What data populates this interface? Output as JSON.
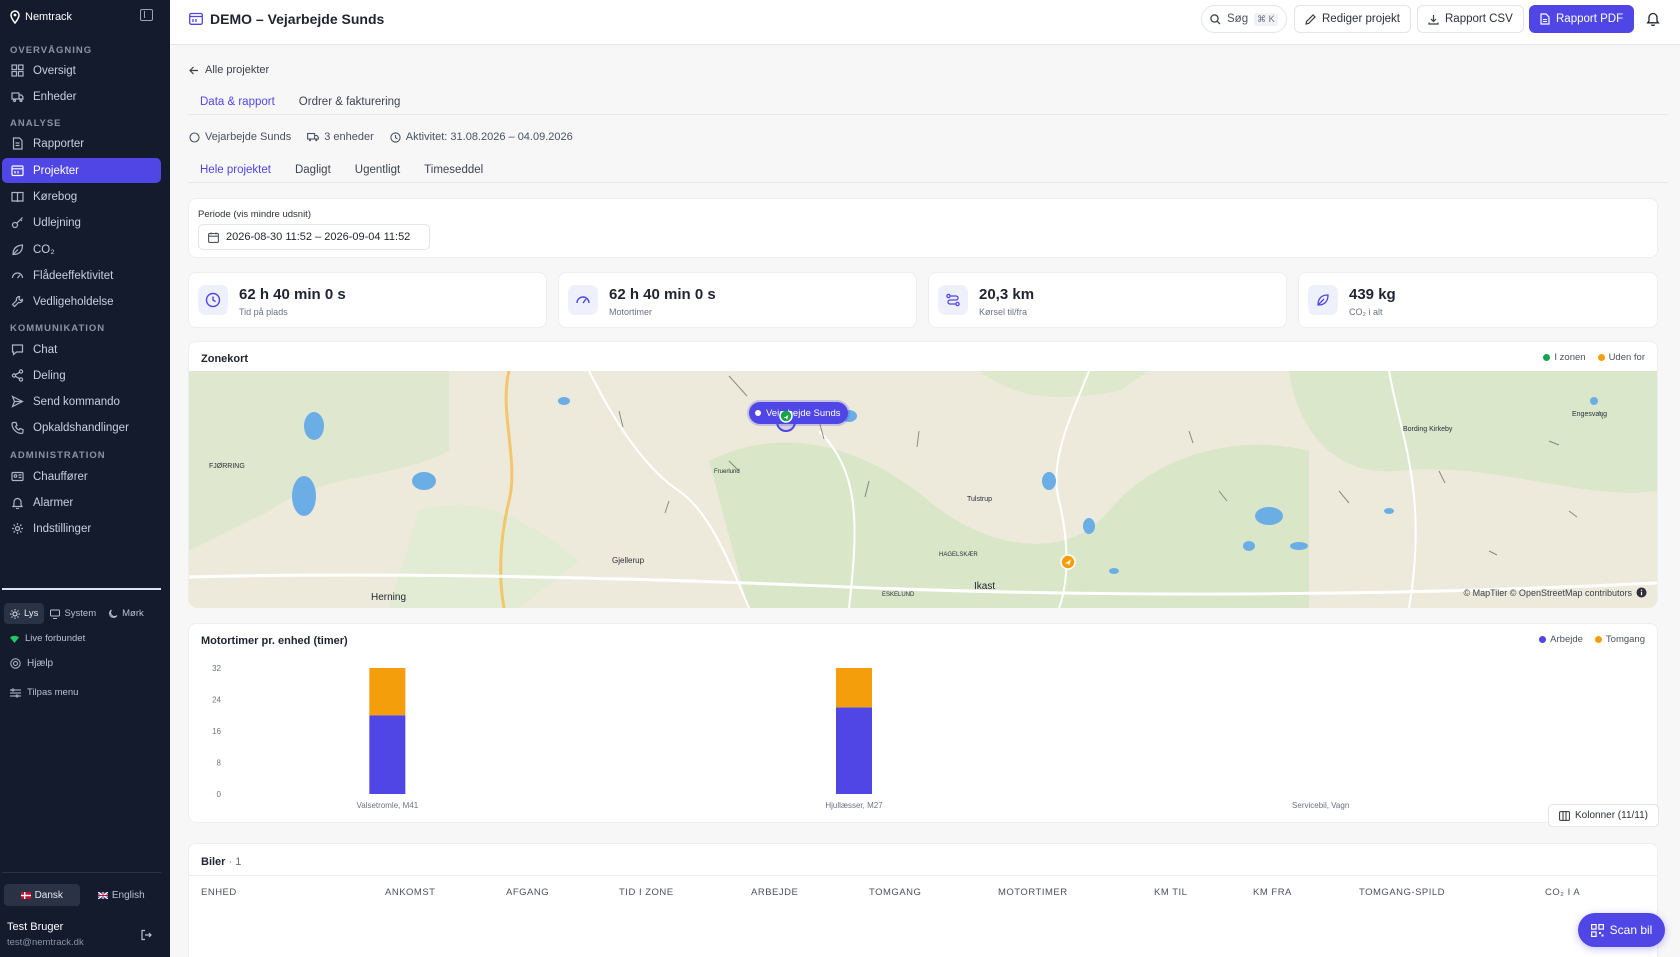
{
  "app": {
    "logo_text": "Nemtrack"
  },
  "sidebar": {
    "sections": [
      {
        "heading": "OVERVÅGNING",
        "items": [
          {
            "label": "Oversigt",
            "icon": "grid-icon"
          },
          {
            "label": "Enheder",
            "icon": "truck-icon"
          }
        ]
      },
      {
        "heading": "ANALYSE",
        "items": [
          {
            "label": "Rapporter",
            "icon": "report-icon"
          },
          {
            "label": "Projekter",
            "icon": "project-icon",
            "active": true
          },
          {
            "label": "Kørebog",
            "icon": "book-icon"
          },
          {
            "label": "Udlejning",
            "icon": "key-icon"
          },
          {
            "label": "CO₂",
            "icon": "leaf-icon"
          },
          {
            "label": "Flådeeffektivitet",
            "icon": "gauge-icon"
          },
          {
            "label": "Vedligeholdelse",
            "icon": "wrench-icon"
          }
        ]
      },
      {
        "heading": "KOMMUNIKATION",
        "items": [
          {
            "label": "Chat",
            "icon": "chat-icon"
          },
          {
            "label": "Deling",
            "icon": "share-icon"
          },
          {
            "label": "Send kommando",
            "icon": "send-icon"
          },
          {
            "label": "Opkaldshandlinger",
            "icon": "phone-icon"
          }
        ]
      },
      {
        "heading": "ADMINISTRATION",
        "items": [
          {
            "label": "Chauffører",
            "icon": "id-card-icon"
          },
          {
            "label": "Alarmer",
            "icon": "bell-icon"
          },
          {
            "label": "Indstillinger",
            "icon": "gear-icon"
          }
        ]
      }
    ],
    "theme": {
      "light": "Lys",
      "system": "System",
      "dark": "Mørk",
      "selected": "Lys"
    },
    "live_status": "Live forbundet",
    "help": "Hjælp",
    "customize_menu": "Tilpas menu",
    "languages": {
      "danish": "Dansk",
      "english": "English",
      "selected": "Dansk"
    },
    "user": {
      "name": "Test Bruger",
      "email": "test@nemtrack.dk"
    }
  },
  "topbar": {
    "title": "DEMO – Vejarbejde Sunds",
    "search_label": "Søg",
    "search_shortcut": "⌘ K",
    "edit_label": "Rediger projekt",
    "csv_label": "Rapport CSV",
    "pdf_label": "Rapport PDF"
  },
  "main": {
    "back_label": "Alle projekter",
    "tabs": [
      {
        "label": "Data & rapport",
        "active": true
      },
      {
        "label": "Ordrer & fakturering"
      }
    ],
    "info": {
      "project": "Vejarbejde Sunds",
      "units": "3 enheder",
      "activity": "Aktivitet: 31.08.2026 – 04.09.2026"
    },
    "subtabs": [
      {
        "label": "Hele projektet",
        "active": true
      },
      {
        "label": "Dagligt"
      },
      {
        "label": "Ugentligt"
      },
      {
        "label": "Timeseddel"
      }
    ],
    "period": {
      "label": "Periode (vis mindre udsnit)",
      "value": "2026-08-30 11:52 – 2026-09-04 11:52"
    },
    "kpis": [
      {
        "value": "62 h 40 min 0 s",
        "label": "Tid på plads",
        "icon": "clock-icon"
      },
      {
        "value": "62 h 40 min 0 s",
        "label": "Motortimer",
        "icon": "gauge-icon"
      },
      {
        "value": "20,3 km",
        "label": "Kørsel til/fra",
        "icon": "route-icon"
      },
      {
        "value": "439 kg",
        "label": "CO₂ i alt",
        "icon": "leaf-icon"
      }
    ],
    "zone_map": {
      "title": "Zonekort",
      "legend_in": "I zonen",
      "legend_out": "Uden for",
      "color_in": "#16a34a",
      "color_out": "#f59e0b",
      "zone_label": "Vejarbejde Sunds",
      "attribution": "© MapTiler © OpenStreetMap contributors",
      "places": [
        "Herning",
        "Ikast",
        "Gjellerup",
        "Tulstrup",
        "Bording Kirkeby",
        "Engesvang",
        "FJØRRING",
        "Fruerlund",
        "HAGELSKÆR",
        "ESKELUND"
      ]
    },
    "columns_button": "Kolonner (11/11)",
    "table": {
      "title": "Biler",
      "count": "· 1",
      "headers": [
        "ENHED",
        "ANKOMST",
        "AFGANG",
        "TID I ZONE",
        "ARBEJDE",
        "TOMGANG",
        "MOTORTIMER",
        "KM TIL",
        "KM FRA",
        "TOMGANG-SPILD",
        "CO₂ I A"
      ]
    },
    "scan_button": "Scan bil"
  },
  "chart_data": {
    "type": "bar",
    "title": "Motortimer pr. enhed (timer)",
    "categories": [
      "Valsetromle, M41",
      "Hjullæsser, M27",
      "Servicebil, Vagn"
    ],
    "series": [
      {
        "name": "Arbejde",
        "values": [
          20,
          22,
          0
        ],
        "color": "#4f46e5"
      },
      {
        "name": "Tomgang",
        "values": [
          12,
          10,
          0
        ],
        "color": "#f59e0b"
      }
    ],
    "stacked": true,
    "ylim": [
      0,
      32
    ],
    "yticks": [
      0,
      8,
      16,
      24,
      32
    ],
    "legend": "top-right"
  }
}
